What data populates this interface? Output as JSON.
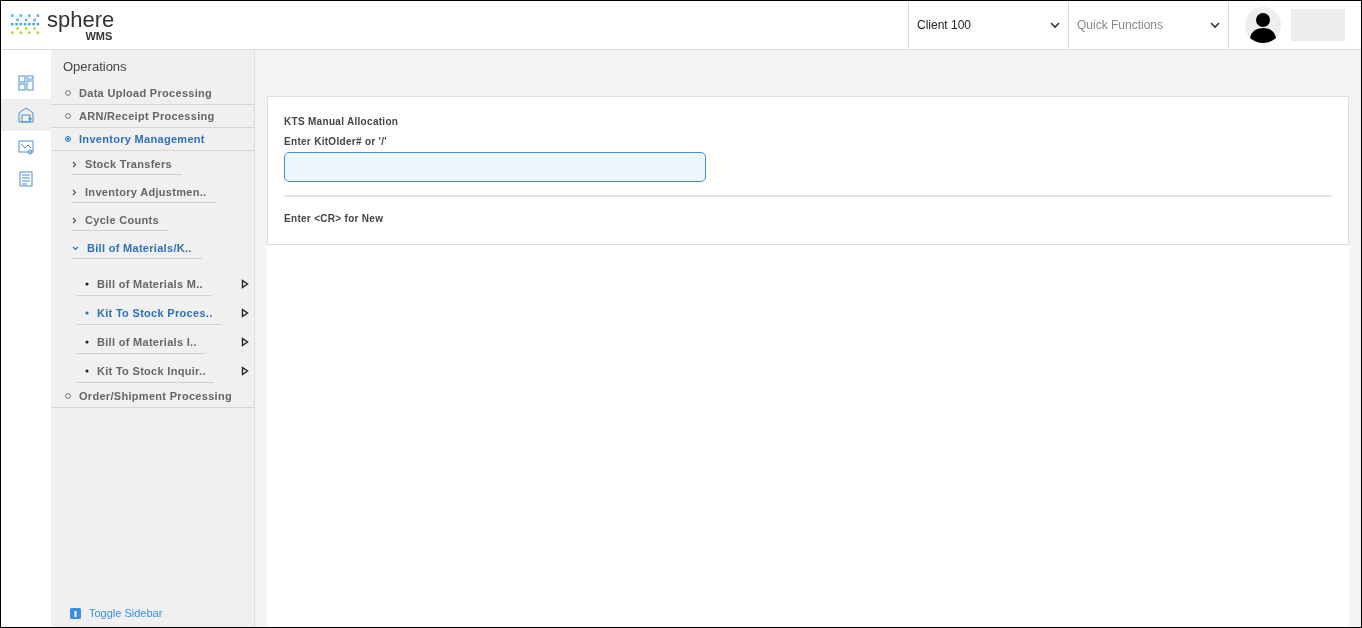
{
  "header": {
    "logo": {
      "name": "sphere",
      "sub": "WMS"
    },
    "client_select": {
      "value": "Client 100"
    },
    "quick_functions": {
      "placeholder": "Quick Functions"
    }
  },
  "rail": [
    {
      "kind": "dashboard",
      "selected": false
    },
    {
      "kind": "warehouse",
      "selected": true
    },
    {
      "kind": "map",
      "selected": false
    },
    {
      "kind": "report",
      "selected": false
    }
  ],
  "sidebar": {
    "title": "Operations",
    "items": [
      {
        "label": "Data Upload Processing",
        "selected": false
      },
      {
        "label": "ARN/Receipt Processing",
        "selected": false
      },
      {
        "label": "Inventory Management",
        "selected": true,
        "children": [
          {
            "label": "Stock Transfers",
            "selected": false,
            "expanded": false
          },
          {
            "label": "Inventory Adjustmen..",
            "selected": false,
            "expanded": false
          },
          {
            "label": "Cycle Counts",
            "selected": false,
            "expanded": false
          },
          {
            "label": "Bill of Materials/K..",
            "selected": true,
            "expanded": true,
            "children": [
              {
                "label": "Bill of Materials M..",
                "selected": false
              },
              {
                "label": "Kit To Stock Proces..",
                "selected": true
              },
              {
                "label": "Bill of Materials I..",
                "selected": false
              },
              {
                "label": "Kit To Stock Inquir..",
                "selected": false
              }
            ]
          }
        ]
      },
      {
        "label": "Order/Shipment Processing",
        "selected": false
      }
    ],
    "toggle": "Toggle Sidebar"
  },
  "form": {
    "title": "KTS Manual Allocation",
    "field_label": "Enter KitOlder# or '/'",
    "focused": true,
    "hint": "Enter <CR> for New"
  }
}
